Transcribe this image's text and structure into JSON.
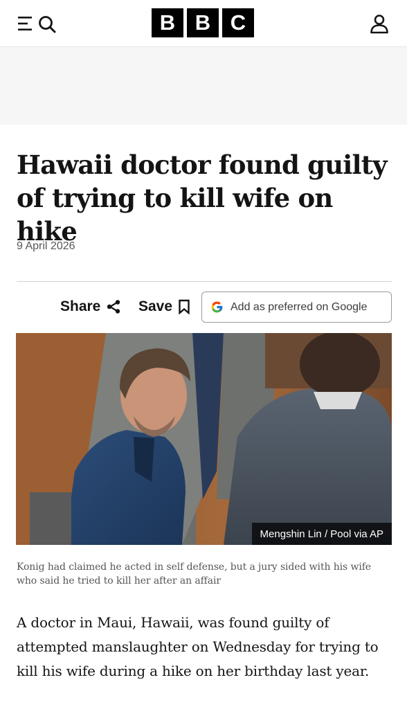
{
  "header": {
    "logo_letters": [
      "B",
      "B",
      "C"
    ],
    "menu_icon": "menu-search-icon",
    "account_icon": "account-icon"
  },
  "article": {
    "headline": "Hawaii doctor found guilty of trying to kill wife on hike",
    "date": "9 April 2026",
    "actions": {
      "share_label": "Share",
      "save_label": "Save",
      "google_label": "Add as preferred on Google"
    },
    "image": {
      "credit": "Mengshin Lin / Pool via AP"
    },
    "caption": "Konig had claimed he acted in self defense, but a jury sided with his wife who said he tried to kill her after an affair",
    "body_first_paragraph": "A doctor in Maui, Hawaii, was found guilty of attempted manslaughter on Wednesday for trying to kill his wife during a hike on her birthday last year."
  },
  "colors": {
    "brand_black": "#000000",
    "text": "#141414",
    "muted": "#545658",
    "ad_band": "#f6f6f6"
  }
}
